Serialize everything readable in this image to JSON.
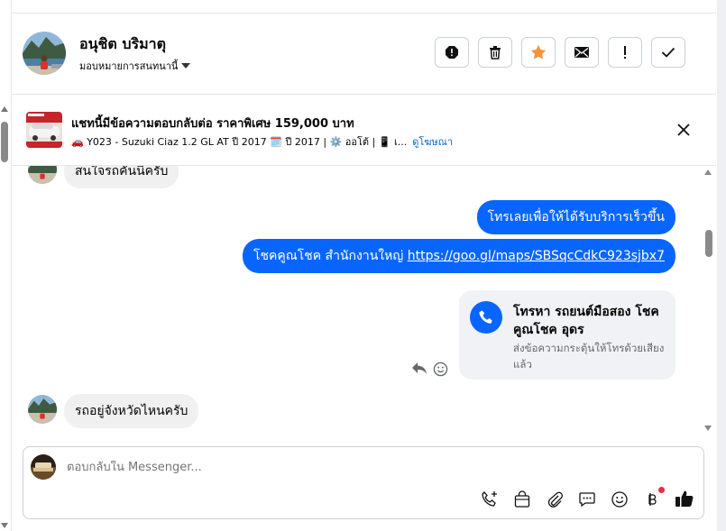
{
  "header": {
    "contact_name": "อนุชิต บริมาตุ",
    "assign_label": "มอบหมายการสนทนานี้"
  },
  "toolbar": {
    "buttons": [
      "report-icon",
      "trash-icon",
      "star-icon",
      "mail-icon",
      "exclamation-icon",
      "check-icon"
    ]
  },
  "ad": {
    "title": "แชทนี้มีข้อความตอบกลับต่อ ราคาพิเศษ 159,000 บาท",
    "details": "🚗 Y023 - Suzuki Ciaz 1.2 GL AT ปี 2017 🗓️ ปี 2017 | ⚙️ ออโต้ | 📱 เ...",
    "link": "ดูโฆษณา"
  },
  "messages": {
    "incoming_1": "สนใจรถคันนี้ครับ",
    "outgoing_1": "โทรเลยเพื่อให้ได้รับบริการเร็วขึ้น",
    "outgoing_2_prefix": "โชคคูณโชค สำนักงานใหญ่ ",
    "outgoing_2_link": "https://goo.gl/maps/SBSqcCdkC923sjbx7",
    "call_title": "โทรหา รถยนต์มือสอง โชคคูณโชค อุดร",
    "call_subtitle": "ส่งข้อความกระตุ้นให้โทรด้วยเสียงแล้ว",
    "incoming_2": "รถอยู่จังหวัดไหนครับ"
  },
  "composer": {
    "placeholder": "ตอบกลับใน Messenger..."
  },
  "composer_icons": [
    "phone-plus-icon",
    "shopping-bag-icon",
    "paperclip-icon",
    "quick-reply-icon",
    "emoji-icon",
    "baht-icon",
    "thumbs-up-icon"
  ],
  "colors": {
    "brand_blue": "#0866ff",
    "star_orange": "#f7923a",
    "link_blue": "#0064d1",
    "notification_red": "#f02849"
  }
}
